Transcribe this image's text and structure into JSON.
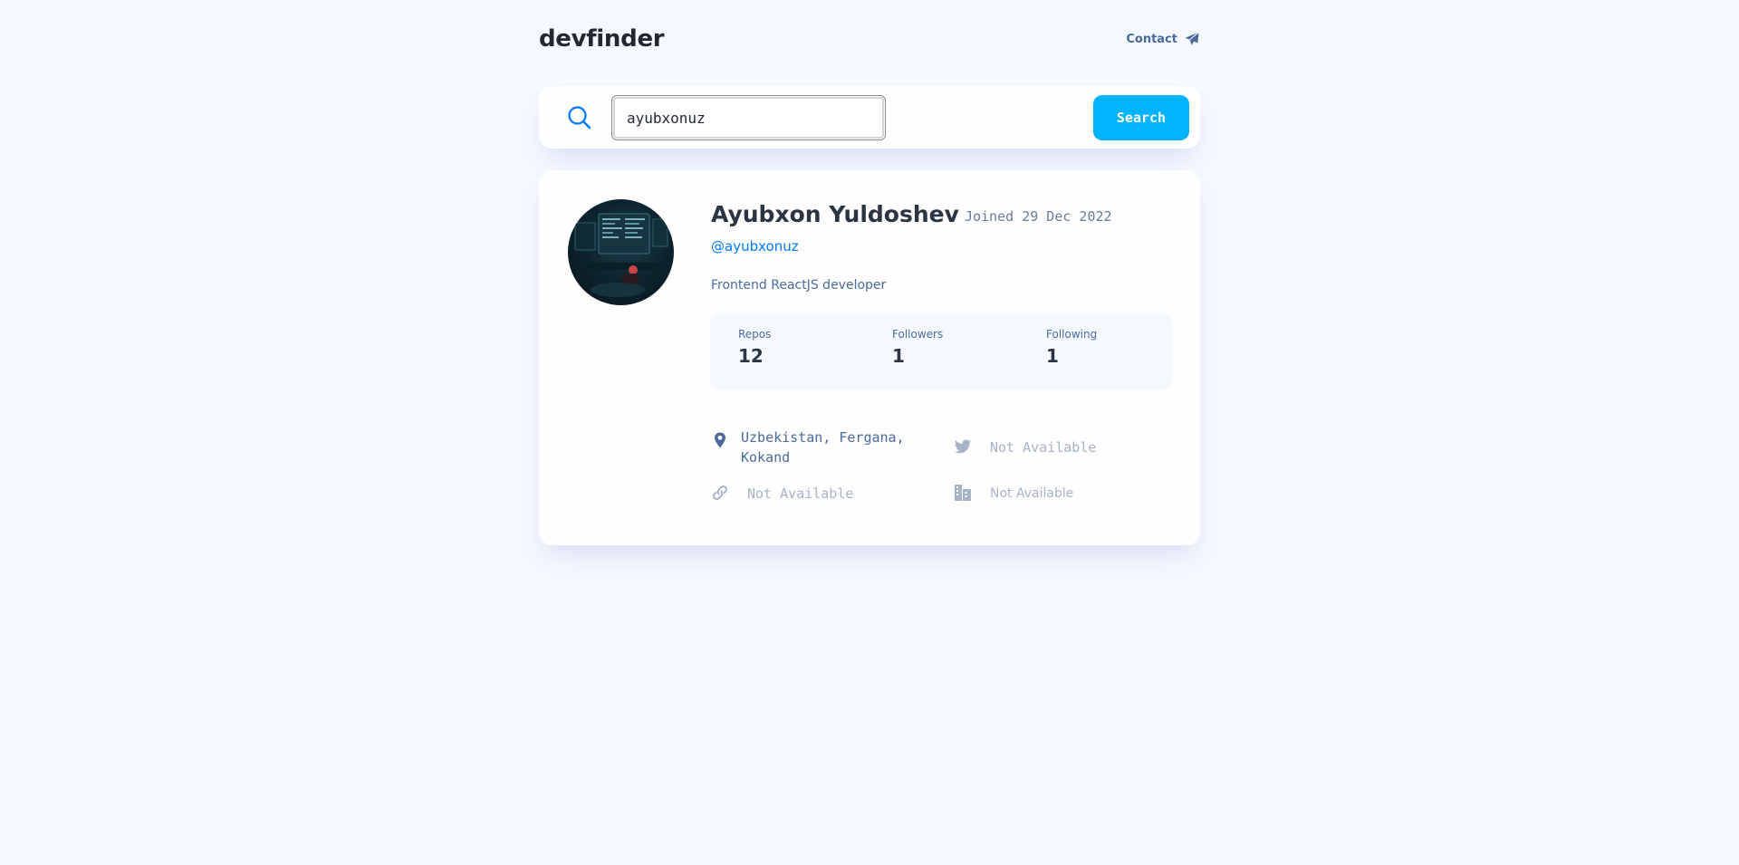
{
  "app": {
    "logo": "devfinder"
  },
  "header": {
    "contact_label": "Contact",
    "contact_icon": "paper-plane-icon"
  },
  "search": {
    "icon": "search-icon",
    "value": "ayubxonuz",
    "button_label": "Search"
  },
  "profile": {
    "name": "Ayubxon Yuldoshev",
    "joined": "Joined 29 Dec 2022",
    "login": "@ayubxonuz",
    "bio": "Frontend ReactJS developer",
    "stats": [
      {
        "label": "Repos",
        "value": "12"
      },
      {
        "label": "Followers",
        "value": "1"
      },
      {
        "label": "Following",
        "value": "1"
      }
    ],
    "links": {
      "location": "Uzbekistan, Fergana, Kokand",
      "twitter": "Not Available",
      "blog": "Not Available",
      "company": "Not Available"
    }
  },
  "colors": {
    "background": "#f5f8ff",
    "accent": "#0079ff",
    "button": "#00b3ff",
    "text_dark": "#2b3442",
    "text_muted": "#4b6a9b",
    "unavailable": "#a7b4c7"
  }
}
